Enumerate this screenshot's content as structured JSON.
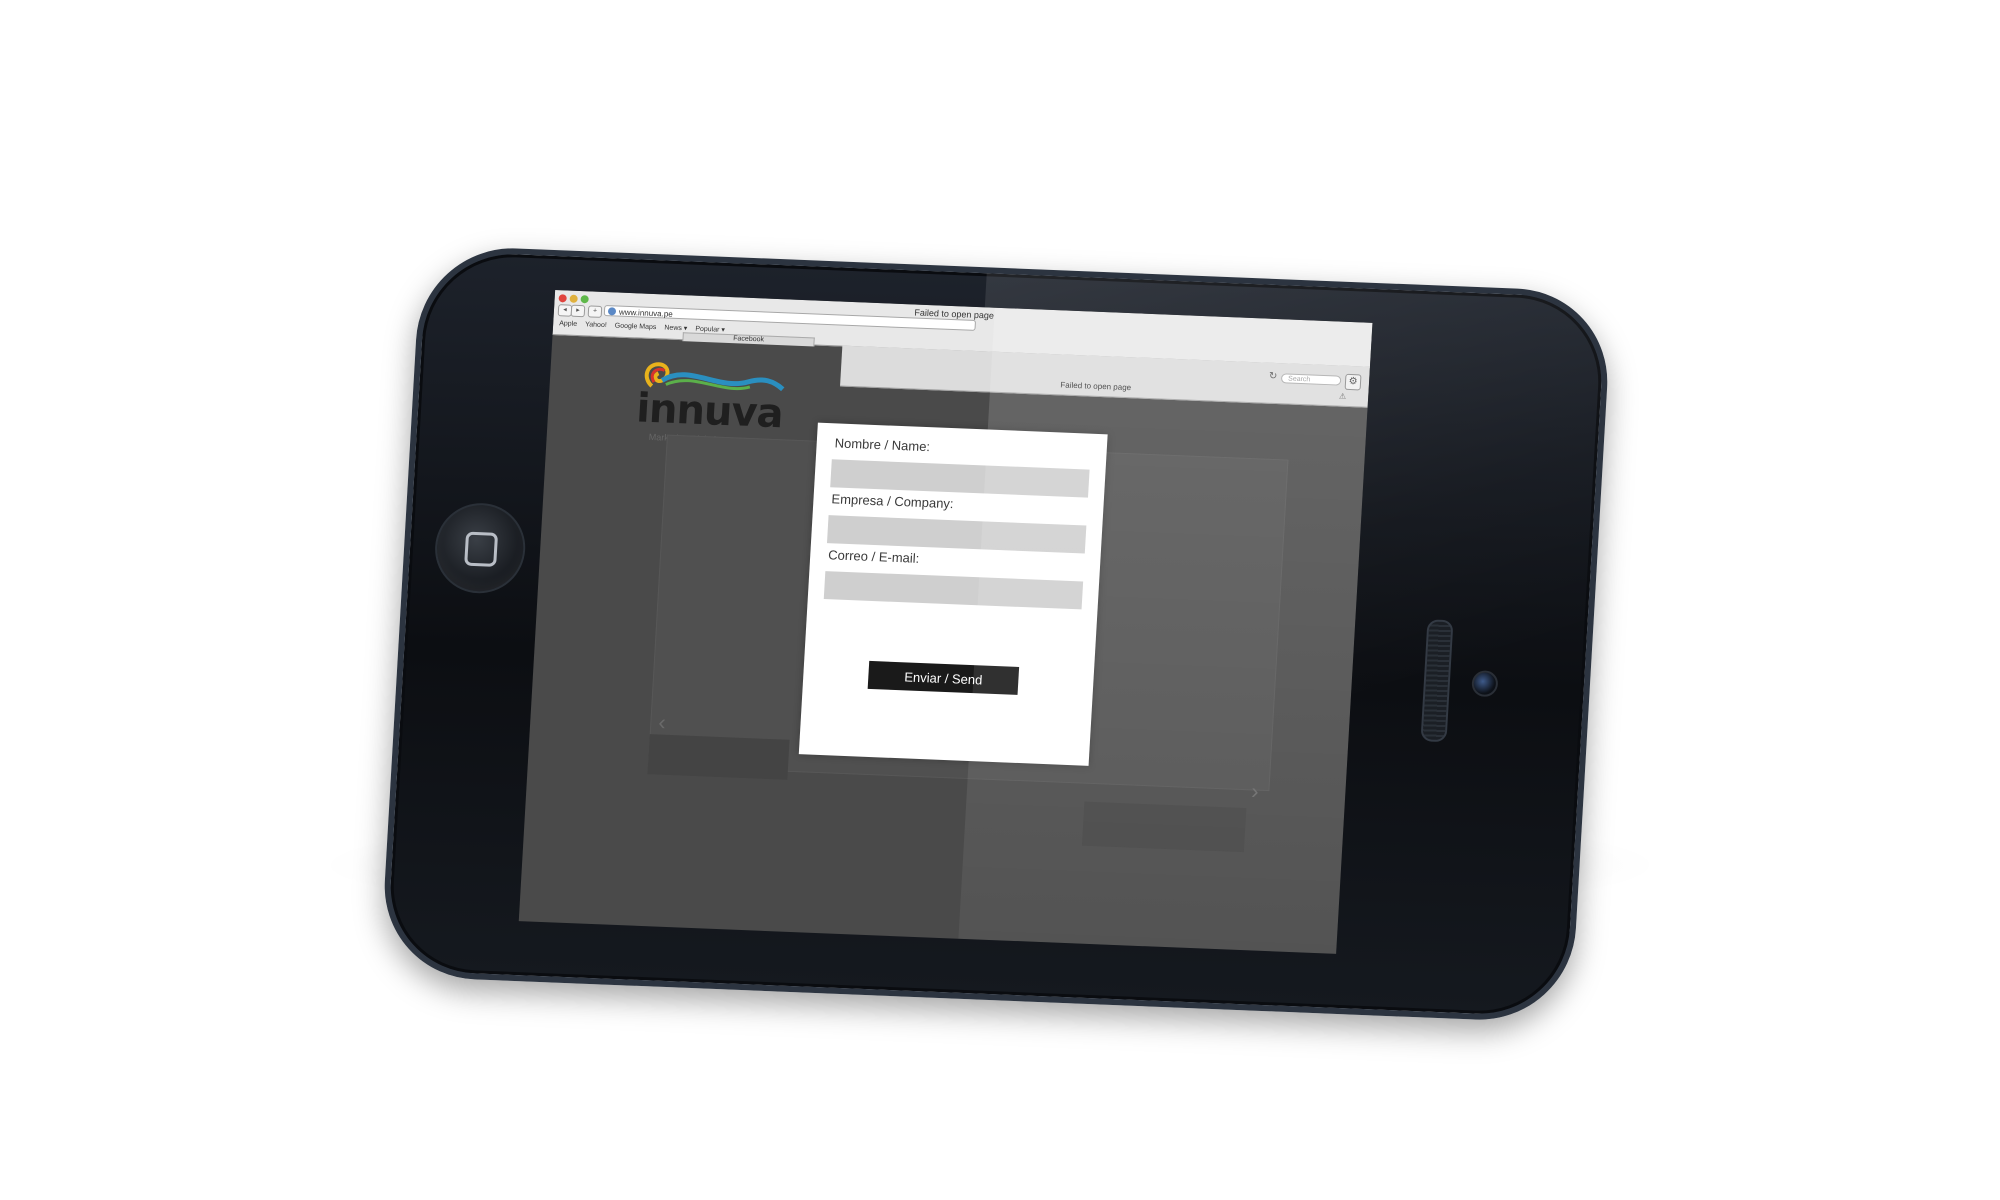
{
  "browser": {
    "url": "www.innuva.pe",
    "page_title": "Failed to open page",
    "bookmarks": [
      "Apple",
      "Yahoo!",
      "Google Maps",
      "News ▾",
      "Popular ▾"
    ],
    "tab_label": "Facebook",
    "inner_title": "Failed to open page",
    "search_placeholder": "Search",
    "nav_back": "◂",
    "nav_forward": "▸",
    "nav_add": "+"
  },
  "logo": {
    "wordmark": "innuva",
    "tagline": "Marketing Digital"
  },
  "form": {
    "name_label": "Nombre / Name:",
    "company_label": "Empresa / Company:",
    "email_label": "Correo / E-mail:",
    "name_value": "",
    "company_value": "",
    "email_value": "",
    "send_label": "Enviar / Send"
  },
  "carousel": {
    "prev_glyph": "‹",
    "next_glyph": "›"
  },
  "colors": {
    "page_background": "#4a4a4a",
    "modal_background": "#ffffff",
    "input_fill": "#cfcfcf",
    "button_fill": "#1a1a1a",
    "phone_body": "#0c0e12"
  }
}
